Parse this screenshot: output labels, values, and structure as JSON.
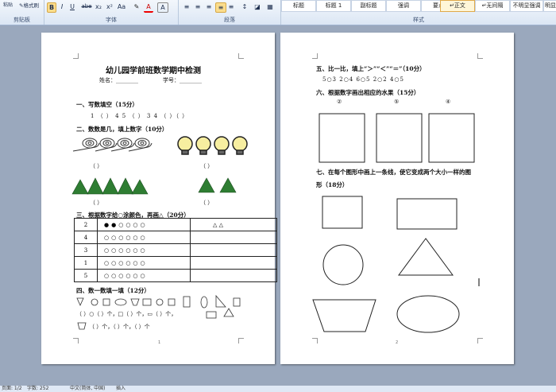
{
  "ribbon": {
    "paste_label": "粘贴",
    "format_painter_label": "格式刷",
    "group_clipboard": "剪贴板",
    "group_font": "字体",
    "group_paragraph": "段落",
    "group_styles": "样式",
    "font_buttons": [
      "B",
      "I",
      "U",
      "abe",
      "x₂",
      "x²",
      "Aa",
      "A",
      "A"
    ],
    "styles": [
      "标题",
      "标题 1",
      "副标题",
      "强调",
      "要点",
      "↵正文",
      "↵无间隔",
      "不明显强调",
      "明显强调"
    ],
    "selected_style": "↵正文"
  },
  "status": {
    "page": "页面: 1/2",
    "words": "字数: 252",
    "language": "中文(简体, 中国)",
    "mode": "插入"
  },
  "page1": {
    "title": "幼儿园学前班数学期中检测",
    "name_label": "姓名：________",
    "id_label": "学号：________",
    "sec1": "一、写数填空（15分）",
    "sec1_line": "1 （ ） 4 5      （ ） 3 4 （ ）（ ）",
    "sec2": "二、数数是几，填上数字（10分）",
    "blank": "（        ）",
    "sec3": "三、根据数字给○涂颜色，再画△（20分）",
    "table": [
      {
        "n": "2",
        "c": "●●○○○○",
        "e": "△ △"
      },
      {
        "n": "4",
        "c": "○○○○○○",
        "e": ""
      },
      {
        "n": "3",
        "c": "○○○○○○",
        "e": ""
      },
      {
        "n": "1",
        "c": "○○○○○○",
        "e": ""
      },
      {
        "n": "5",
        "c": "○○○○○○",
        "e": ""
      }
    ],
    "sec4": "四、数一数填一填（12分）",
    "count_line1": "（ ）○（ ）个，□（ ）个，▭（ ）个，",
    "count_line2": "（ ）个，（ ）个，（ ）个",
    "page_num": "1"
  },
  "page2": {
    "sec5": "五、比一比，填上“＞”“＜”“＝”（10分）",
    "sec5_line": "5○3     2○4     6○5     2○2     4○5",
    "sec6": "六、根据数字画出相应的水果（15分）",
    "circ_nums": [
      "②",
      "⑤",
      "④"
    ],
    "sec7": "七、在每个图形中画上一条线，使它变成两个大小一样的图",
    "sec7b": "形（18分）",
    "page_num": "2"
  }
}
